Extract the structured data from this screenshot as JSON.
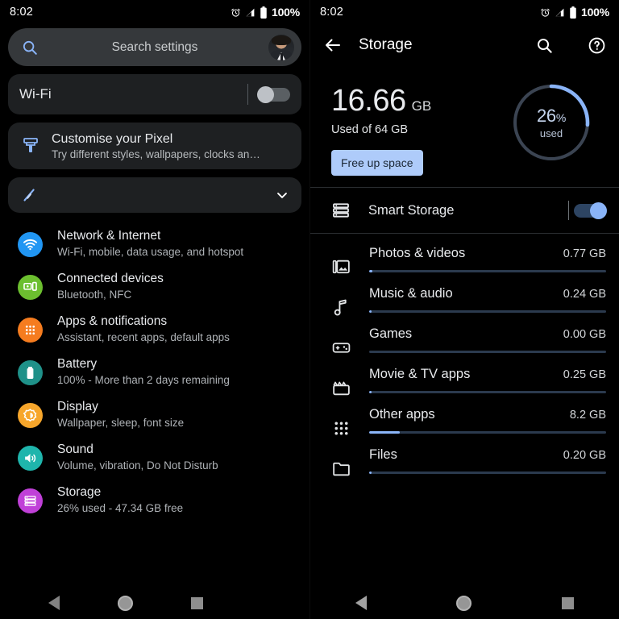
{
  "status_bar": {
    "time": "8:02",
    "battery": "100%",
    "icons": [
      "alarm-icon",
      "signal-icon",
      "battery-icon"
    ]
  },
  "left_panel": {
    "search": {
      "placeholder": "Search settings",
      "icon": "search-icon",
      "avatar": "user-avatar"
    },
    "wifi_card": {
      "label": "Wi-Fi",
      "toggle_state": "off"
    },
    "customise_card": {
      "title": "Customise your Pixel",
      "subtitle": "Try different styles, wallpapers, clocks an…",
      "icon": "paintbrush-icon"
    },
    "collapsed_card": {
      "icon": "tips-icon",
      "chevron": "chevron-down-icon"
    },
    "settings": [
      {
        "title": "Network & Internet",
        "subtitle": "Wi-Fi, mobile, data usage, and hotspot",
        "icon": "wifi-icon",
        "color": "#2196f3"
      },
      {
        "title": "Connected devices",
        "subtitle": "Bluetooth, NFC",
        "icon": "devices-icon",
        "color": "#6cbf2f"
      },
      {
        "title": "Apps & notifications",
        "subtitle": "Assistant, recent apps, default apps",
        "icon": "apps-grid-icon",
        "color": "#f57c1f"
      },
      {
        "title": "Battery",
        "subtitle": "100% - More than 2 days remaining",
        "icon": "battery-icon",
        "color": "#1f9189"
      },
      {
        "title": "Display",
        "subtitle": "Wallpaper, sleep, font size",
        "icon": "brightness-icon",
        "color": "#f7a62b"
      },
      {
        "title": "Sound",
        "subtitle": "Volume, vibration, Do Not Disturb",
        "icon": "volume-icon",
        "color": "#1fb5ac"
      },
      {
        "title": "Storage",
        "subtitle": "26% used - 47.34 GB free",
        "icon": "storage-icon",
        "color": "#c040d8"
      }
    ]
  },
  "right_panel": {
    "appbar": {
      "title": "Storage",
      "back_icon": "arrow-back-icon",
      "search_icon": "search-icon",
      "help_icon": "help-circle-icon"
    },
    "summary": {
      "used_value": "16.66",
      "used_unit": "GB",
      "used_of": "Used of 64 GB",
      "free_up_label": "Free up space",
      "donut_percent": "26",
      "donut_percent_symbol": "%",
      "donut_caption": "used",
      "accent_color": "#8ab4f8",
      "button_color": "#aecbfa"
    },
    "smart_storage": {
      "label": "Smart Storage",
      "icon": "list-icon",
      "toggle_state": "on"
    },
    "categories": [
      {
        "name": "Photos & videos",
        "size": "0.77 GB",
        "icon": "photo-stack-icon",
        "fill_percent": 1.2
      },
      {
        "name": "Music & audio",
        "size": "0.24 GB",
        "icon": "music-note-icon",
        "fill_percent": 0.4
      },
      {
        "name": "Games",
        "size": "0.00 GB",
        "icon": "gamepad-icon",
        "fill_percent": 0
      },
      {
        "name": "Movie & TV apps",
        "size": "0.25 GB",
        "icon": "clapperboard-icon",
        "fill_percent": 0.4
      },
      {
        "name": "Other apps",
        "size": "8.2 GB",
        "icon": "apps-grid-icon",
        "fill_percent": 12.8
      },
      {
        "name": "Files",
        "size": "0.20 GB",
        "icon": "folder-icon",
        "fill_percent": 0.3
      }
    ]
  },
  "nav_bar": {
    "back": "nav-back-icon",
    "home": "nav-home-icon",
    "recents": "nav-recents-icon"
  }
}
